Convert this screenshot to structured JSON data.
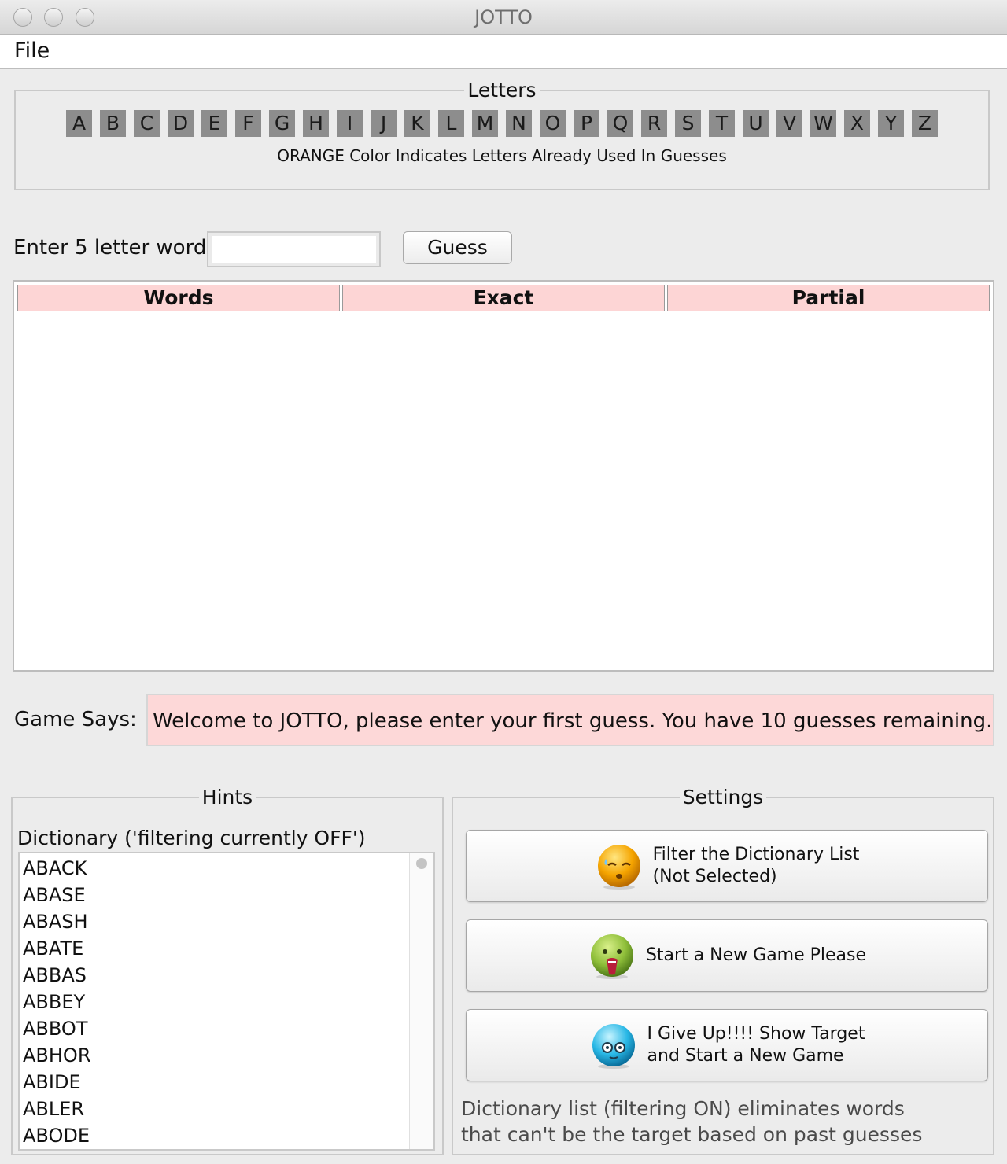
{
  "window": {
    "title": "JOTTO"
  },
  "menu": {
    "file": "File"
  },
  "letters": {
    "group_title": "Letters",
    "items": [
      "A",
      "B",
      "C",
      "D",
      "E",
      "F",
      "G",
      "H",
      "I",
      "J",
      "K",
      "L",
      "M",
      "N",
      "O",
      "P",
      "Q",
      "R",
      "S",
      "T",
      "U",
      "V",
      "W",
      "X",
      "Y",
      "Z"
    ],
    "note": "ORANGE Color Indicates Letters Already Used In Guesses"
  },
  "guess": {
    "label": "Enter 5 letter word",
    "value": "",
    "button": "Guess"
  },
  "table": {
    "columns": [
      "Words",
      "Exact",
      "Partial"
    ],
    "rows": []
  },
  "game_says": {
    "label": "Game Says:",
    "message": "Welcome to JOTTO, please enter your first guess. You have 10 guesses remaining."
  },
  "hints": {
    "group_title": "Hints",
    "dictionary_label": "Dictionary ('filtering currently OFF')",
    "words": [
      "ABACK",
      "ABASE",
      "ABASH",
      "ABATE",
      "ABBAS",
      "ABBEY",
      "ABBOT",
      "ABHOR",
      "ABIDE",
      "ABLER",
      "ABODE"
    ]
  },
  "settings": {
    "group_title": "Settings",
    "filter_button": {
      "line1": "Filter the Dictionary List",
      "line2": "(Not Selected)",
      "icon": "sweating-orange-face-icon"
    },
    "new_game_button": {
      "label": "Start a New Game Please",
      "icon": "green-shouting-face-icon"
    },
    "give_up_button": {
      "line1": "I Give Up!!!! Show Target",
      "line2": "and Start a New Game",
      "icon": "blue-scared-face-icon"
    },
    "note_line1": "Dictionary list (filtering ON) eliminates words",
    "note_line2": "that can't be the target based on past guesses"
  }
}
